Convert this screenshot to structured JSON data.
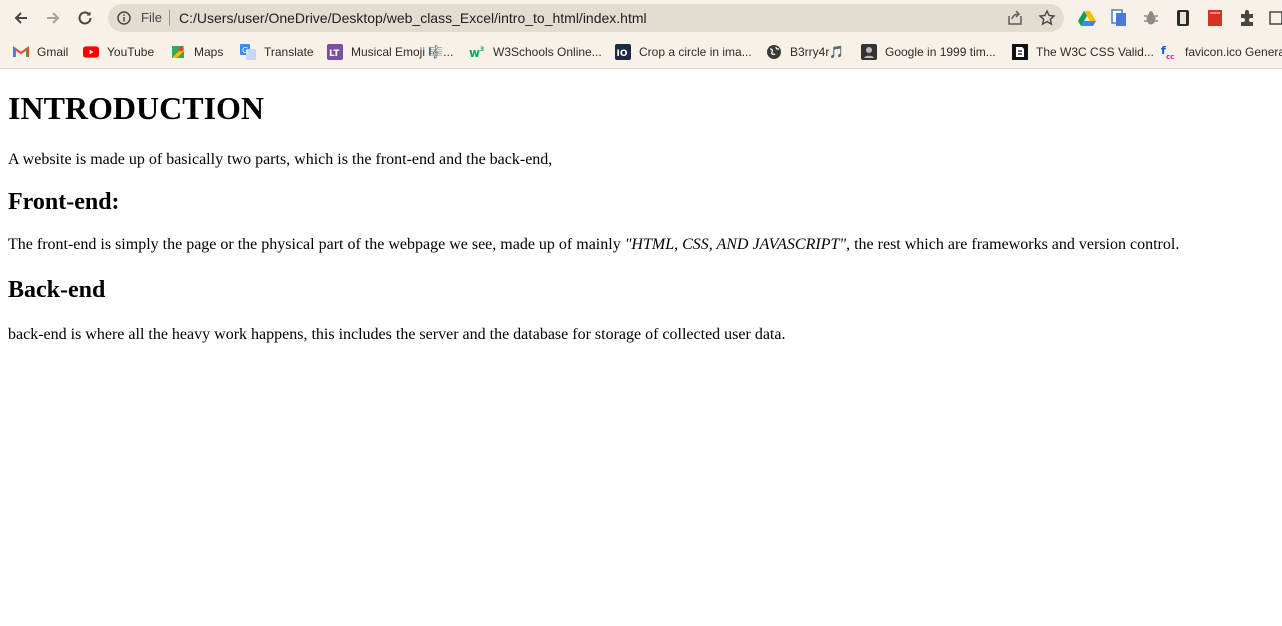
{
  "browser": {
    "url_scheme": "File",
    "url": "C:/Users/user/OneDrive/Desktop/web_class_Excel/intro_to_html/index.html",
    "icons": {
      "back": "arrow-left-icon",
      "forward": "arrow-right-icon",
      "reload": "reload-icon",
      "info": "info-circle-icon",
      "share": "share-icon",
      "bookmark_star": "star-icon",
      "extensions": [
        "google-drive-icon",
        "copy-icon",
        "bug-icon",
        "reader-icon",
        "bookmark-red-icon",
        "puzzle-icon",
        "square-icon"
      ]
    },
    "bookmarks": [
      {
        "label": "Gmail",
        "icon": "gmail-icon"
      },
      {
        "label": "YouTube",
        "icon": "youtube-icon"
      },
      {
        "label": "Maps",
        "icon": "maps-icon"
      },
      {
        "label": "Translate",
        "icon": "translate-icon"
      },
      {
        "label": "Musical Emoji 🎼...",
        "icon": "lt-icon"
      },
      {
        "label": "W3Schools Online...",
        "icon": "w3schools-icon"
      },
      {
        "label": "Crop a circle in ima...",
        "icon": "io-icon"
      },
      {
        "label": "B3rry4r🎵",
        "icon": "globe-icon"
      },
      {
        "label": "Google in 1999 tim...",
        "icon": "google-1999-icon"
      },
      {
        "label": "The W3C CSS Valid...",
        "icon": "w3c-icon"
      },
      {
        "label": "favicon.ico Genera",
        "icon": "favicon-cc-icon"
      }
    ],
    "colors": {
      "chrome_bg": "#f7f1e8",
      "omnibox_bg": "#e2dcd1"
    }
  },
  "page": {
    "h1": "INTRODUCTION",
    "intro": "A website is made up of basically two parts, which is the front-end and the back-end,",
    "frontend_heading": "Front-end:",
    "frontend_text_before": "The front-end is simply the page or the physical part of the webpage we see, made up of mainly ",
    "frontend_text_em": "\"HTML, CSS, AND JAVASCRIPT\"",
    "frontend_text_after": ", the rest which are frameworks and version control.",
    "backend_heading": "Back-end",
    "backend_text": "back-end is where all the heavy work happens, this includes the server and the database for storage of collected user data."
  }
}
